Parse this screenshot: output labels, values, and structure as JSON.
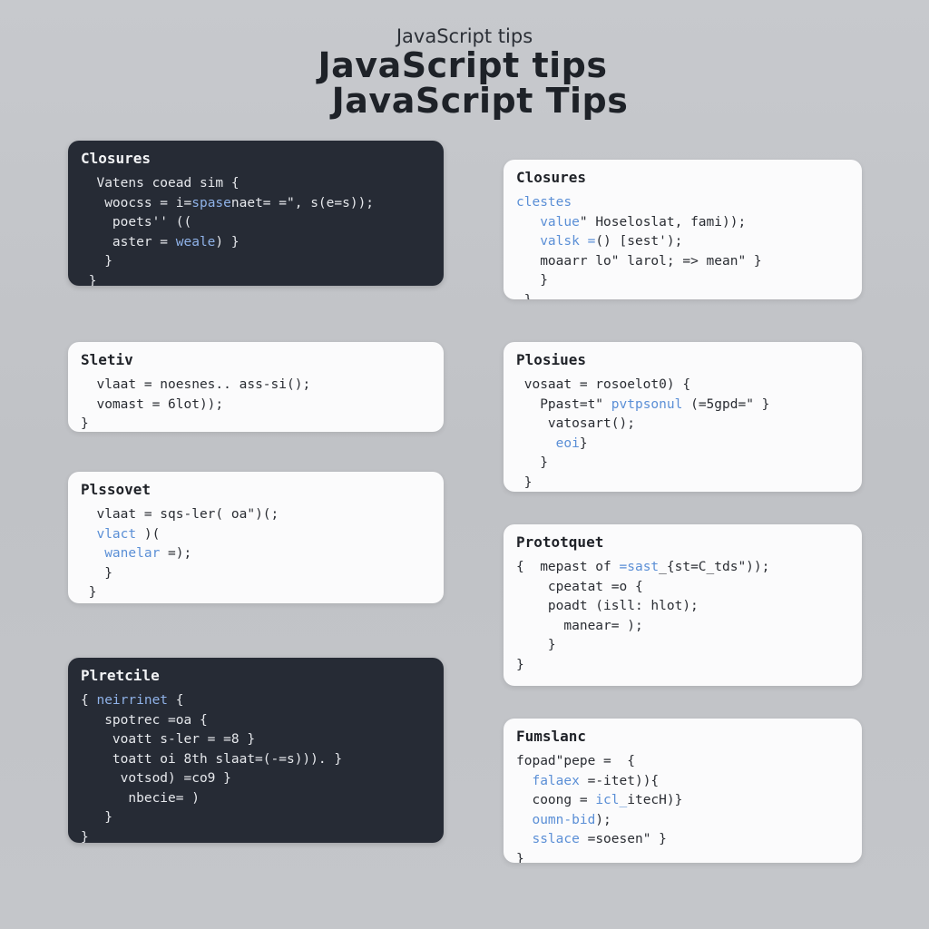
{
  "header": {
    "subtitle": "JavaScript tips",
    "title_line1": "JavaScript tips",
    "title_line2": "JavaScript Tips"
  },
  "cards": [
    {
      "id": "card-closures-dark",
      "theme": "dark",
      "title": "Closures",
      "lines": [
        {
          "indent": "  ",
          "pre": "Vatens coead sim {",
          "hl": "",
          "post": ""
        },
        {
          "indent": "   ",
          "pre": "woocss = i=",
          "hl": "spase",
          "post": "naet= =\", s(e=s));"
        },
        {
          "indent": "    ",
          "pre": "poets'' ((",
          "hl": "",
          "post": ""
        },
        {
          "indent": "    ",
          "pre": "aster = ",
          "hl": "weale",
          "post": ") }"
        },
        {
          "indent": "   ",
          "pre": "}",
          "hl": "",
          "post": ""
        },
        {
          "indent": " ",
          "pre": "}",
          "hl": "",
          "post": ""
        }
      ]
    },
    {
      "id": "card-closures-light",
      "theme": "light",
      "title": "Closures",
      "lines": [
        {
          "indent": "",
          "pre": "",
          "hl": "clestes",
          "post": ""
        },
        {
          "indent": "   ",
          "pre": "",
          "hl": "value",
          "post": "\" Hoseloslat, fami));"
        },
        {
          "indent": "   ",
          "pre": "",
          "hl": "valsk =",
          "post": "() [sest');"
        },
        {
          "indent": "   ",
          "pre": "moaarr lo\" larol; => mean\" }",
          "hl": "",
          "post": ""
        },
        {
          "indent": "   ",
          "pre": "}",
          "hl": "",
          "post": ""
        },
        {
          "indent": " ",
          "pre": "}",
          "hl": "",
          "post": ""
        }
      ]
    },
    {
      "id": "card-sletiv",
      "theme": "light",
      "title": "Sletiv",
      "lines": [
        {
          "indent": "  ",
          "pre": "vlaat = noesnes.. ass-si();",
          "hl": "",
          "post": ""
        },
        {
          "indent": "  ",
          "pre": "vomast = 6lot));",
          "hl": "",
          "post": ""
        },
        {
          "indent": "",
          "pre": "}",
          "hl": "",
          "post": ""
        }
      ]
    },
    {
      "id": "card-plosiues",
      "theme": "light",
      "title": "Plosiues",
      "lines": [
        {
          "indent": " ",
          "pre": "vosaat = rosoelot0) {",
          "hl": "",
          "post": ""
        },
        {
          "indent": "   ",
          "pre": "Ppast=t\" ",
          "hl": "pvtpsonul",
          "post": " (=5gpd=\" }"
        },
        {
          "indent": "    ",
          "pre": "vatosart();",
          "hl": "",
          "post": ""
        },
        {
          "indent": "     ",
          "pre": "",
          "hl": "eoi",
          "post": "}"
        },
        {
          "indent": "   ",
          "pre": "}",
          "hl": "",
          "post": ""
        },
        {
          "indent": " ",
          "pre": "}",
          "hl": "",
          "post": ""
        }
      ]
    },
    {
      "id": "card-plssovet",
      "theme": "light",
      "title": "Plssovet",
      "lines": [
        {
          "indent": "  ",
          "pre": "vlaat = sqs-ler( oa\")(;",
          "hl": "",
          "post": ""
        },
        {
          "indent": "  ",
          "pre": "",
          "hl": "vlact",
          "post": " )("
        },
        {
          "indent": "   ",
          "pre": "",
          "hl": "wanelar",
          "post": " =);"
        },
        {
          "indent": "   ",
          "pre": "}",
          "hl": "",
          "post": ""
        },
        {
          "indent": " ",
          "pre": "}",
          "hl": "",
          "post": ""
        }
      ]
    },
    {
      "id": "card-prototquet",
      "theme": "light",
      "title": "Prototquet",
      "lines": [
        {
          "indent": "",
          "pre": "{  mepast of ",
          "hl": "=sast",
          "post": "_{st=C_tds\"));"
        },
        {
          "indent": "    ",
          "pre": "cpeatat =o {",
          "hl": "",
          "post": ""
        },
        {
          "indent": "    ",
          "pre": "poadt (isll: hlot);",
          "hl": "",
          "post": ""
        },
        {
          "indent": "      ",
          "pre": "manear= );",
          "hl": "",
          "post": ""
        },
        {
          "indent": "    ",
          "pre": "}",
          "hl": "",
          "post": ""
        },
        {
          "indent": "",
          "pre": "}",
          "hl": "",
          "post": ""
        }
      ]
    },
    {
      "id": "card-plretcile",
      "theme": "dark",
      "title": "Plretcile",
      "lines": [
        {
          "indent": "",
          "pre": "{ ",
          "hl": "neirrinet",
          "post": " {"
        },
        {
          "indent": "   ",
          "pre": "spotrec =oa {",
          "hl": "",
          "post": ""
        },
        {
          "indent": "    ",
          "pre": "voatt s-ler = =8 }",
          "hl": "",
          "post": ""
        },
        {
          "indent": "    ",
          "pre": "toatt oi 8th slaat=(-=s))). }",
          "hl": "",
          "post": ""
        },
        {
          "indent": "     ",
          "pre": "votsod) =co9 }",
          "hl": "",
          "post": ""
        },
        {
          "indent": "      ",
          "pre": "nbecie= )",
          "hl": "",
          "post": ""
        },
        {
          "indent": "   ",
          "pre": "}",
          "hl": "",
          "post": ""
        },
        {
          "indent": "",
          "pre": "}",
          "hl": "",
          "post": ""
        }
      ]
    },
    {
      "id": "card-fumslanc",
      "theme": "light",
      "title": "Fumslanc",
      "lines": [
        {
          "indent": "",
          "pre": "fopad\"pepe =  {",
          "hl": "",
          "post": ""
        },
        {
          "indent": "  ",
          "pre": "",
          "hl": "falaex",
          "post": " =-itet)){"
        },
        {
          "indent": "  ",
          "pre": "coong = ",
          "hl": "icl_",
          "post": "itecH)}"
        },
        {
          "indent": "  ",
          "pre": "",
          "hl": "oumn-bid",
          "post": ");"
        },
        {
          "indent": "  ",
          "pre": "",
          "hl": "sslace",
          "post": " =soesen\" }"
        },
        {
          "indent": "",
          "pre": "}",
          "hl": "",
          "post": ""
        }
      ]
    }
  ]
}
